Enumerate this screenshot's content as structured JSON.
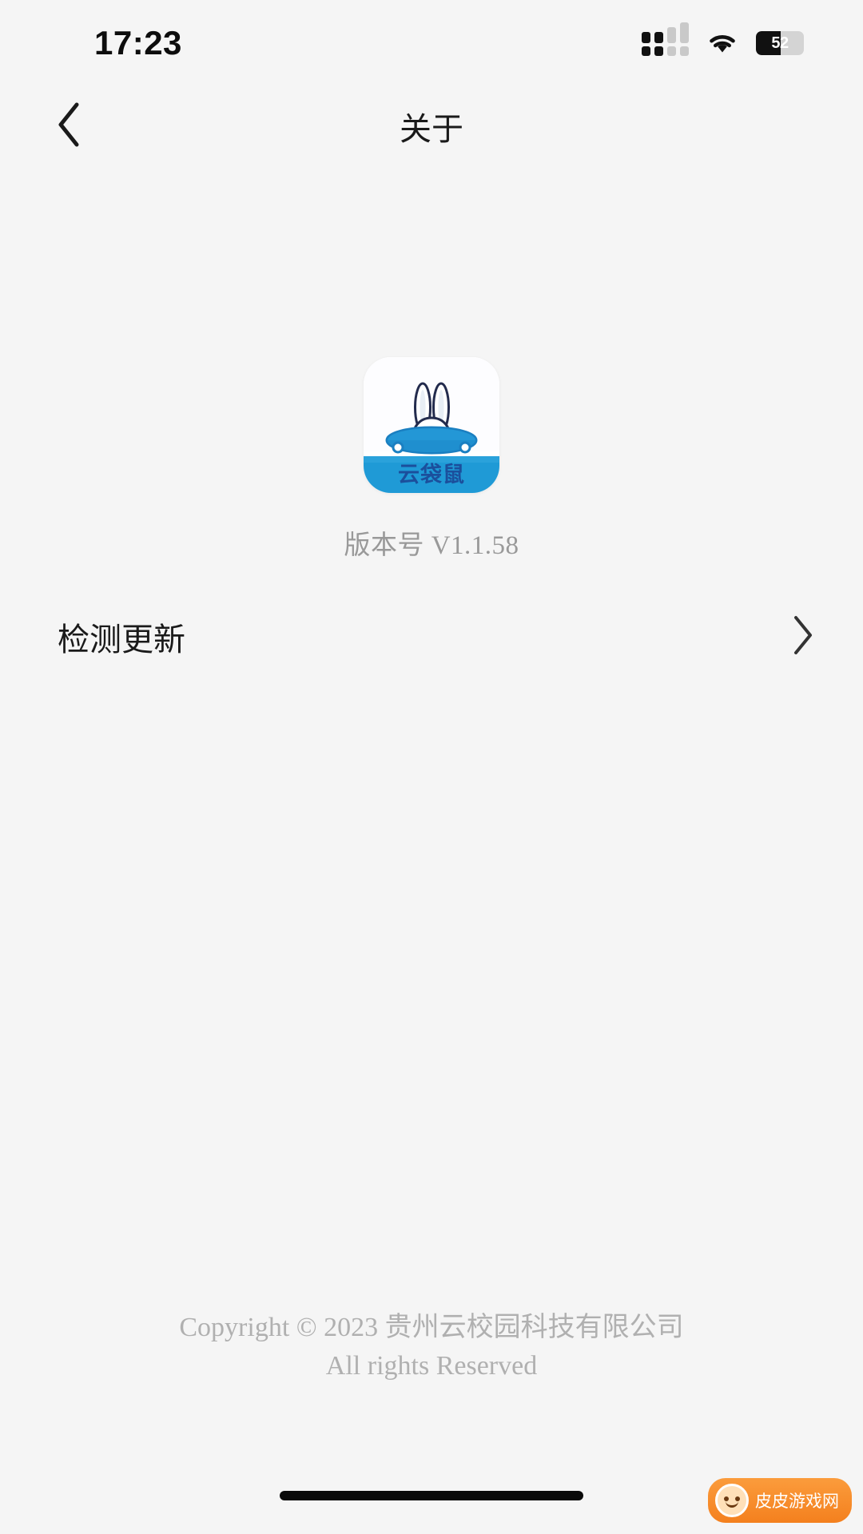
{
  "statusbar": {
    "time": "17:23",
    "battery_percent": "52",
    "battery_level": 52,
    "signal_icon": "signal-bars-icon",
    "wifi_icon": "wifi-icon",
    "battery_icon": "battery-icon"
  },
  "navbar": {
    "title": "关于",
    "back_icon": "chevron-left-icon"
  },
  "app": {
    "logo_alt": "云袋鼠",
    "logo_brand_text": "云袋鼠",
    "version_label": "版本号 V1.1.58",
    "logo_colors": {
      "primary_blue": "#1a9ad7",
      "deep_blue": "#1b6fb5",
      "outline": "#222a4a",
      "background": "#ffffff"
    }
  },
  "update": {
    "label": "检测更新",
    "chevron_icon": "chevron-right-icon"
  },
  "footer": {
    "line1": "Copyright © 2023 贵州云校园科技有限公司",
    "line2": "All rights Reserved"
  },
  "watermark": {
    "text": "皮皮游戏网",
    "face_icon": "cartoon-face-icon",
    "color": "#f4801e"
  }
}
